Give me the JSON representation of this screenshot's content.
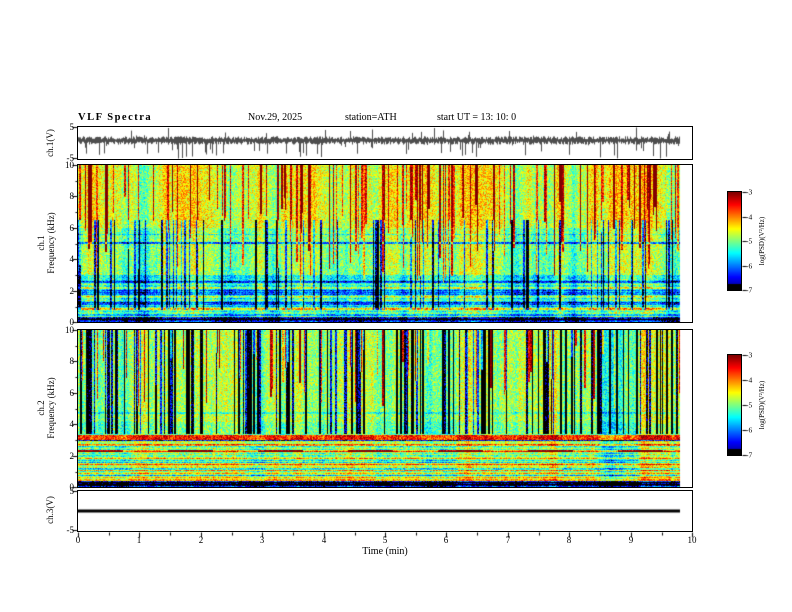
{
  "header": {
    "title": "VLF  Spectra",
    "date": "Nov.29, 2025",
    "station": "station=ATH",
    "start_ut": "start UT  =   13: 10: 0"
  },
  "axes": {
    "x_label": "Time  (min)",
    "x_ticks": [
      "0",
      "1",
      "2",
      "3",
      "4",
      "5",
      "6",
      "7",
      "8",
      "9",
      "10"
    ],
    "wave_y_ticks": [
      "5",
      "-5"
    ],
    "spec_y_ticks": [
      "10",
      "8",
      "6",
      "4",
      "2",
      "0"
    ],
    "colorbar_ticks": [
      "-3",
      "-4",
      "-5",
      "-6",
      "-7"
    ],
    "colorbar_label": "log(PSD)(V²/Hz)"
  },
  "panels": {
    "ch1_wave_label": "ch.1(V)",
    "ch1_spec_label_line1": "ch.1",
    "ch1_spec_label_line2": "Frequency  (kHz)",
    "ch2_spec_label_line1": "ch.2",
    "ch2_spec_label_line2": "Frequency  (kHz)",
    "ch3_label": "ch.3(V)"
  },
  "chart_data": [
    {
      "type": "line",
      "name": "ch.1 time series",
      "ylabel": "ch.1(V)",
      "xlabel": "Time (min)",
      "x_range": [
        0,
        10
      ],
      "y_range": [
        -5,
        5
      ],
      "y_ticks": [
        5,
        -5
      ],
      "description": "Broadband noisy waveform fluctuating around ~0.5 V with dense impulsive spikes, many reaching down to -5 V; trace runs from 0 to about 9.8 min."
    },
    {
      "type": "heatmap",
      "name": "ch.1 spectrogram",
      "xlabel": "Time (min)",
      "ylabel": "Frequency (kHz)",
      "x_range": [
        0,
        10
      ],
      "y_range": [
        0,
        10
      ],
      "y_ticks": [
        10,
        8,
        6,
        4,
        2,
        0
      ],
      "color_scale": {
        "label": "log(PSD)(V²/Hz)",
        "range": [
          -7,
          -3
        ],
        "ticks": [
          -3,
          -4,
          -5,
          -6,
          -7
        ],
        "colormap": "jet, black below ~-6.8"
      },
      "features": [
        "mostly green background near -5",
        "frequent red/orange vertical impulsive streaks, strongest above ~4 kHz",
        "cyan/blue vertical dropouts between ~1 and 6 kHz",
        "horizontal striping and darker bands below ~3 kHz",
        "thin dark horizontal line near 5 kHz",
        "black band at the bottom near 0 kHz"
      ]
    },
    {
      "type": "heatmap",
      "name": "ch.2 spectrogram",
      "xlabel": "Time (min)",
      "ylabel": "Frequency (kHz)",
      "x_range": [
        0,
        10
      ],
      "y_range": [
        0,
        10
      ],
      "y_ticks": [
        10,
        8,
        6,
        4,
        2,
        0
      ],
      "color_scale": {
        "label": "log(PSD)(V²/Hz)",
        "range": [
          -7,
          -3
        ],
        "ticks": [
          -3,
          -4,
          -5,
          -6,
          -7
        ],
        "colormap": "jet, black below ~-6.8"
      },
      "features": [
        "green/yellow background near -4.8",
        "strong dark-blue vertical streaks above ~3.5 kHz",
        "bright orange horizontal line near 3.2 kHz",
        "regular horizontal green/yellow banding below ~3 kHz with dashed orange segments",
        "sparse red impulsive streaks at high frequency",
        "black band at the bottom near 0 kHz"
      ]
    },
    {
      "type": "line",
      "name": "ch.3 time series",
      "ylabel": "ch.3(V)",
      "xlabel": "Time (min)",
      "x_range": [
        0,
        10
      ],
      "y_range": [
        -5,
        5
      ],
      "y_ticks": [
        5,
        -5
      ],
      "values": "constant 0 V — flat thick black line from 0 to ~9.8 min"
    }
  ]
}
